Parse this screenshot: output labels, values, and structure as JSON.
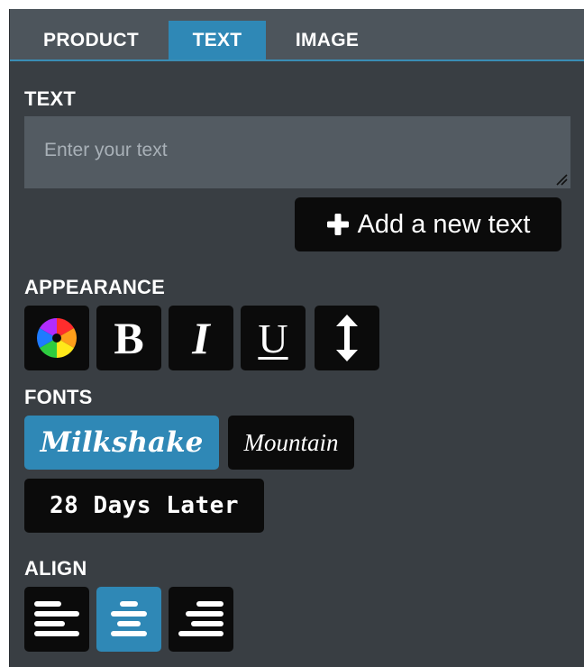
{
  "tabs": [
    {
      "label": "PRODUCT",
      "active": false
    },
    {
      "label": "TEXT",
      "active": true
    },
    {
      "label": "IMAGE",
      "active": false
    }
  ],
  "text_section": {
    "label": "TEXT",
    "placeholder": "Enter your text",
    "value": "",
    "add_button_label": "Add a new text"
  },
  "appearance": {
    "label": "APPEARANCE",
    "buttons": [
      {
        "icon": "color-wheel-icon"
      },
      {
        "icon": "bold-icon",
        "glyph": "B"
      },
      {
        "icon": "italic-icon",
        "glyph": "I"
      },
      {
        "icon": "underline-icon",
        "glyph": "U"
      },
      {
        "icon": "line-height-arrow-icon"
      }
    ]
  },
  "fonts": {
    "label": "FONTS",
    "options": [
      {
        "name": "Milkshake",
        "selected": true
      },
      {
        "name": "Mountain",
        "selected": false
      },
      {
        "name": "28 Days Later",
        "selected": false
      }
    ]
  },
  "align": {
    "label": "ALIGN",
    "options": [
      {
        "value": "left",
        "icon": "align-left-icon",
        "active": false
      },
      {
        "value": "center",
        "icon": "align-center-icon",
        "active": true
      },
      {
        "value": "right",
        "icon": "align-right-icon",
        "active": false
      }
    ]
  },
  "colors": {
    "panel_bg": "#393e43",
    "tabbar_bg": "#4d555c",
    "accent": "#2f88b6",
    "button_bg": "#0b0b0b",
    "input_bg": "#535b62"
  }
}
